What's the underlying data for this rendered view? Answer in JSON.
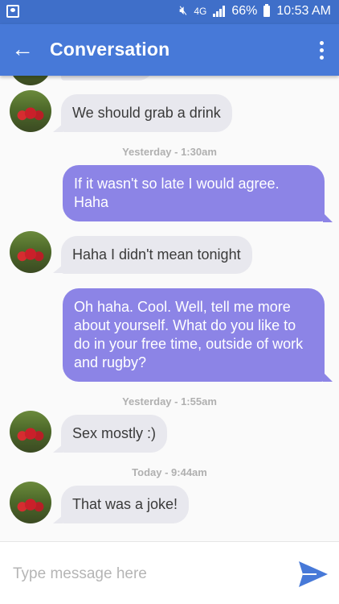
{
  "status_bar": {
    "network": "4G",
    "battery": "66%",
    "time": "10:53 AM"
  },
  "header": {
    "title": "Conversation"
  },
  "messages": [
    {
      "type": "in",
      "text": "We should grab a drink"
    },
    {
      "type": "timestamp",
      "text": "Yesterday - 1:30am"
    },
    {
      "type": "out",
      "text": "If it wasn't so late I would agree. Haha"
    },
    {
      "type": "in",
      "text": "Haha I didn't mean tonight"
    },
    {
      "type": "out",
      "text": "Oh haha. Cool. Well, tell me more about yourself. What do you like to do in your free time, outside of work and rugby?"
    },
    {
      "type": "timestamp",
      "text": "Yesterday - 1:55am"
    },
    {
      "type": "in",
      "text": "Sex mostly :)"
    },
    {
      "type": "timestamp",
      "text": "Today - 9:44am"
    },
    {
      "type": "in",
      "text": "That was a joke!"
    }
  ],
  "composer": {
    "placeholder": "Type message here"
  },
  "colors": {
    "header": "#4779d8",
    "status_bar": "#3f6fc9",
    "outgoing_bubble": "#8c84e6",
    "incoming_bubble": "#e8e8ee",
    "send_icon": "#4779d8"
  }
}
